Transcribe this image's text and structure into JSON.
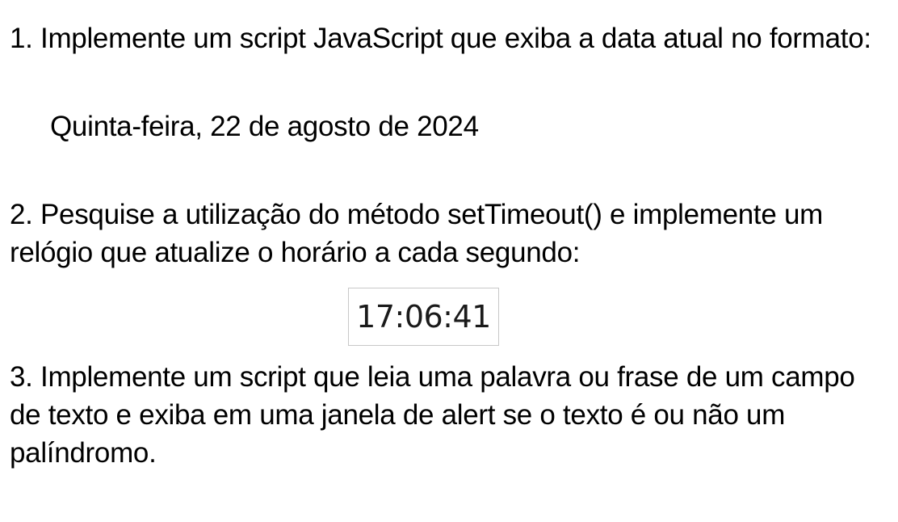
{
  "exercises": [
    {
      "text": "1. Implemente um script JavaScript que exiba a data atual no formato:"
    },
    {
      "text": "2. Pesquise a utilização do método setTimeout() e implemente um relógio que atualize o horário a cada segundo:"
    },
    {
      "text": "3. Implemente um script que leia uma palavra ou frase de um campo de texto e exiba em uma janela de alert se o texto é ou não um palíndromo."
    }
  ],
  "date_example": "Quinta-feira, 22 de agosto de 2024",
  "clock_example": "17:06:41"
}
